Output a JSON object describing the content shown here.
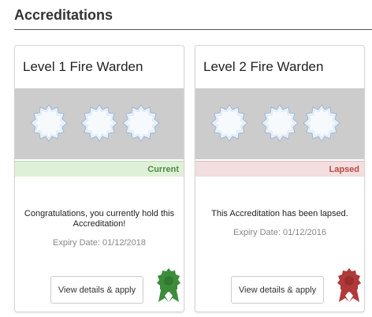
{
  "section": {
    "title": "Accreditations"
  },
  "cards": [
    {
      "title": "Level 1 Fire Warden",
      "status": "Current",
      "message": "Congratulations, you currently hold this Accreditation!",
      "expiry": "Expiry Date: 01/12/2018",
      "button_label": "View details & apply",
      "badge_icon": "award-ribbon-icon",
      "badge_color": "#3c8c3c"
    },
    {
      "title": "Level 2 Fire Warden",
      "status": "Lapsed",
      "message": "This Accreditation has been lapsed.",
      "expiry": "Expiry Date: 01/12/2016",
      "button_label": "View details & apply",
      "badge_icon": "award-ribbon-icon",
      "badge_color": "#b03a3a"
    }
  ],
  "colors": {
    "current_bg": "#dff0d8",
    "current_text": "#4f8c42",
    "lapsed_bg": "#f2dede",
    "lapsed_text": "#b94a48",
    "banner": "#cccccc"
  }
}
